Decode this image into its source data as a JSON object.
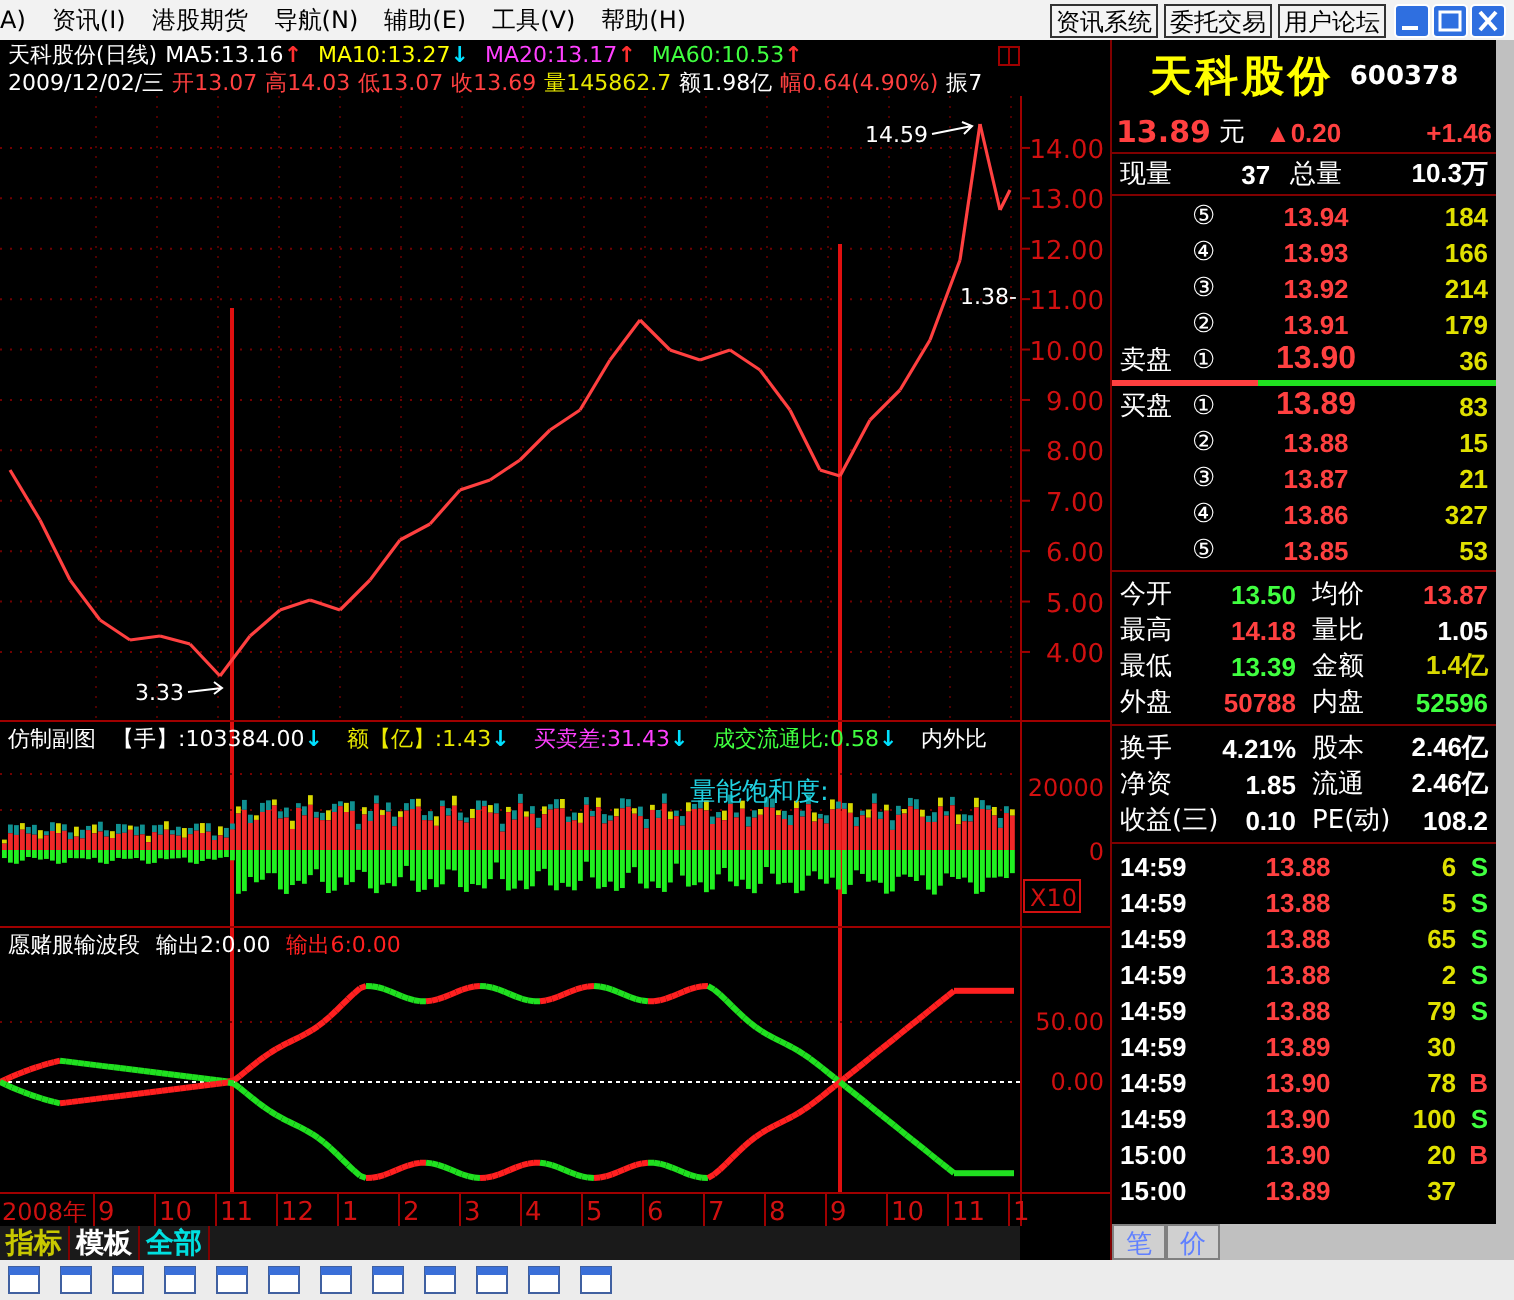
{
  "menu": {
    "items": [
      "A)",
      "资讯(I)",
      "港股期货",
      "导航(N)",
      "辅助(E)",
      "工具(V)",
      "帮助(H)"
    ],
    "buttons": [
      "资讯系统",
      "委托交易",
      "用户论坛"
    ]
  },
  "chart_header": {
    "title": "天科股份(日线)",
    "ma": [
      {
        "label": "MA5:13.16",
        "color": "#ffffff",
        "arrow": {
          "text": "↑",
          "color": "#ff3030"
        }
      },
      {
        "label": "MA10:13.27",
        "color": "#ffff00",
        "arrow": {
          "text": "↓",
          "color": "#00e0ff"
        }
      },
      {
        "label": "MA20:13.17",
        "color": "#ff40ff",
        "arrow": {
          "text": "↑",
          "color": "#ff3030"
        }
      },
      {
        "label": "MA60:10.53",
        "color": "#40ff40",
        "arrow": {
          "text": "↑",
          "color": "#ff3030"
        }
      }
    ],
    "quote": [
      {
        "text": "2009/12/02/三",
        "color": "#ffffff"
      },
      {
        "text": "开13.07",
        "color": "#ff4040"
      },
      {
        "text": "高14.03",
        "color": "#ff4040"
      },
      {
        "text": "低13.07",
        "color": "#ff4040"
      },
      {
        "text": "收13.69",
        "color": "#ff4040"
      },
      {
        "text": "量145862.7",
        "color": "#e8e800"
      },
      {
        "text": "额1.98亿",
        "color": "#ffffff"
      },
      {
        "text": "幅0.64(4.90%)",
        "color": "#ff4040"
      },
      {
        "text": "振7",
        "color": "#ffffff"
      }
    ]
  },
  "main_chart": {
    "x_axis": [
      "9",
      "10",
      "11",
      "12",
      "1",
      "2",
      "3",
      "4",
      "5",
      "6",
      "7",
      "8",
      "9",
      "10",
      "11",
      "1"
    ],
    "price_axis": [
      "14.00",
      "13.00",
      "12.00",
      "11.00",
      "10.00",
      "9.00",
      "8.00",
      "7.00",
      "6.00",
      "5.00",
      "4.00"
    ],
    "high_label": "14.59",
    "low_label": "3.33",
    "side_note": "1.38-",
    "year_label": "2008年"
  },
  "volume_panel": {
    "title": "仿制副图",
    "indicators": [
      {
        "label": "【手】:103384.00",
        "color": "#ffffff",
        "arrow": {
          "text": "↓",
          "color": "#00e0ff"
        }
      },
      {
        "label": "额【亿】:1.43",
        "color": "#e8e800",
        "arrow": {
          "text": "↓",
          "color": "#00e0ff"
        }
      },
      {
        "label": "买卖差:31.43",
        "color": "#ff40ff",
        "arrow": {
          "text": "↓",
          "color": "#00e0ff"
        }
      },
      {
        "label": "成交流通比:0.58",
        "color": "#40ff40",
        "arrow": {
          "text": "↓",
          "color": "#00e0ff"
        }
      },
      {
        "label": "内外比",
        "color": "#ffffff"
      }
    ],
    "overlay_label": "量能饱和度:",
    "axis_labels": [
      "20000",
      "0"
    ],
    "scale_badge": "X10"
  },
  "wave_panel": {
    "title": "愿赌服输波段",
    "outputs": [
      {
        "label": "输出2:0.00",
        "color": "#ffffff"
      },
      {
        "label": "输出6:0.00",
        "color": "#ff2020"
      }
    ],
    "axis_labels": [
      "50.00",
      "0.00"
    ]
  },
  "bottom_tabs": [
    "指标",
    "模板",
    "全部"
  ],
  "quote_panel": {
    "name": "天科股份",
    "code": "600378",
    "price": "13.89",
    "unit": "元",
    "change": "▲0.20",
    "change_pct": "+1.46",
    "volume_label": "现量",
    "volume": "37",
    "total_label": "总量",
    "total": "10.3万",
    "asks": [
      {
        "index": "⑤",
        "price": "13.94",
        "size": "184",
        "best": false
      },
      {
        "index": "④",
        "price": "13.93",
        "size": "166",
        "best": false
      },
      {
        "index": "③",
        "price": "13.92",
        "size": "214",
        "best": false
      },
      {
        "index": "②",
        "price": "13.91",
        "size": "179",
        "best": false
      },
      {
        "label": "卖盘",
        "index": "①",
        "price": "13.90",
        "size": "36",
        "best": true
      }
    ],
    "ratio": {
      "level": 0.38
    },
    "bids": [
      {
        "label": "买盘",
        "index": "①",
        "price": "13.89",
        "size": "83",
        "best": true
      },
      {
        "index": "②",
        "price": "13.88",
        "size": "15",
        "best": false
      },
      {
        "index": "③",
        "price": "13.87",
        "size": "21",
        "best": false
      },
      {
        "index": "④",
        "price": "13.86",
        "size": "327",
        "best": false
      },
      {
        "index": "⑤",
        "price": "13.85",
        "size": "53",
        "best": false
      }
    ],
    "stats": [
      {
        "label": "今开",
        "value": "13.50",
        "color": "#40ff40"
      },
      {
        "label": "均价",
        "value": "13.87",
        "color": "#ff4040"
      },
      {
        "label": "最高",
        "value": "14.18",
        "color": "#ff4040"
      },
      {
        "label": "量比",
        "value": "1.05",
        "color": "#ffffff"
      },
      {
        "label": "最低",
        "value": "13.39",
        "color": "#40ff40"
      },
      {
        "label": "金额",
        "value": "1.4亿",
        "color": "#d8d800"
      },
      {
        "label": "外盘",
        "value": "50788",
        "color": "#ff4040"
      },
      {
        "label": "内盘",
        "value": "52596",
        "color": "#40ff40"
      }
    ],
    "fundamentals": [
      {
        "label": "换手",
        "value": "4.21%"
      },
      {
        "label": "股本",
        "value": "2.46亿"
      },
      {
        "label": "净资",
        "value": "1.85"
      },
      {
        "label": "流通",
        "value": "2.46亿"
      },
      {
        "label": "收益(三)",
        "value": "0.10"
      },
      {
        "label": "PE(动)",
        "value": "108.2"
      }
    ],
    "ticks": [
      {
        "time": "14:59",
        "price": "13.88",
        "volume": "6",
        "side": "S",
        "kind": "sell"
      },
      {
        "time": "14:59",
        "price": "13.88",
        "volume": "5",
        "side": "S",
        "kind": "sell"
      },
      {
        "time": "14:59",
        "price": "13.88",
        "volume": "65",
        "side": "S",
        "kind": "sell"
      },
      {
        "time": "14:59",
        "price": "13.88",
        "volume": "2",
        "side": "S",
        "kind": "sell"
      },
      {
        "time": "14:59",
        "price": "13.88",
        "volume": "79",
        "side": "S",
        "kind": "sell"
      },
      {
        "time": "14:59",
        "price": "13.89",
        "volume": "30",
        "kind": "none"
      },
      {
        "time": "14:59",
        "price": "13.90",
        "volume": "78",
        "side": "B",
        "kind": "buy"
      },
      {
        "time": "14:59",
        "price": "13.90",
        "volume": "100",
        "side": "S",
        "kind": "sell"
      },
      {
        "time": "15:00",
        "price": "13.90",
        "volume": "20",
        "side": "B",
        "kind": "buy"
      },
      {
        "time": "15:00",
        "price": "13.89",
        "volume": "37",
        "kind": "none"
      }
    ],
    "tabs": [
      "笔",
      "价"
    ]
  }
}
